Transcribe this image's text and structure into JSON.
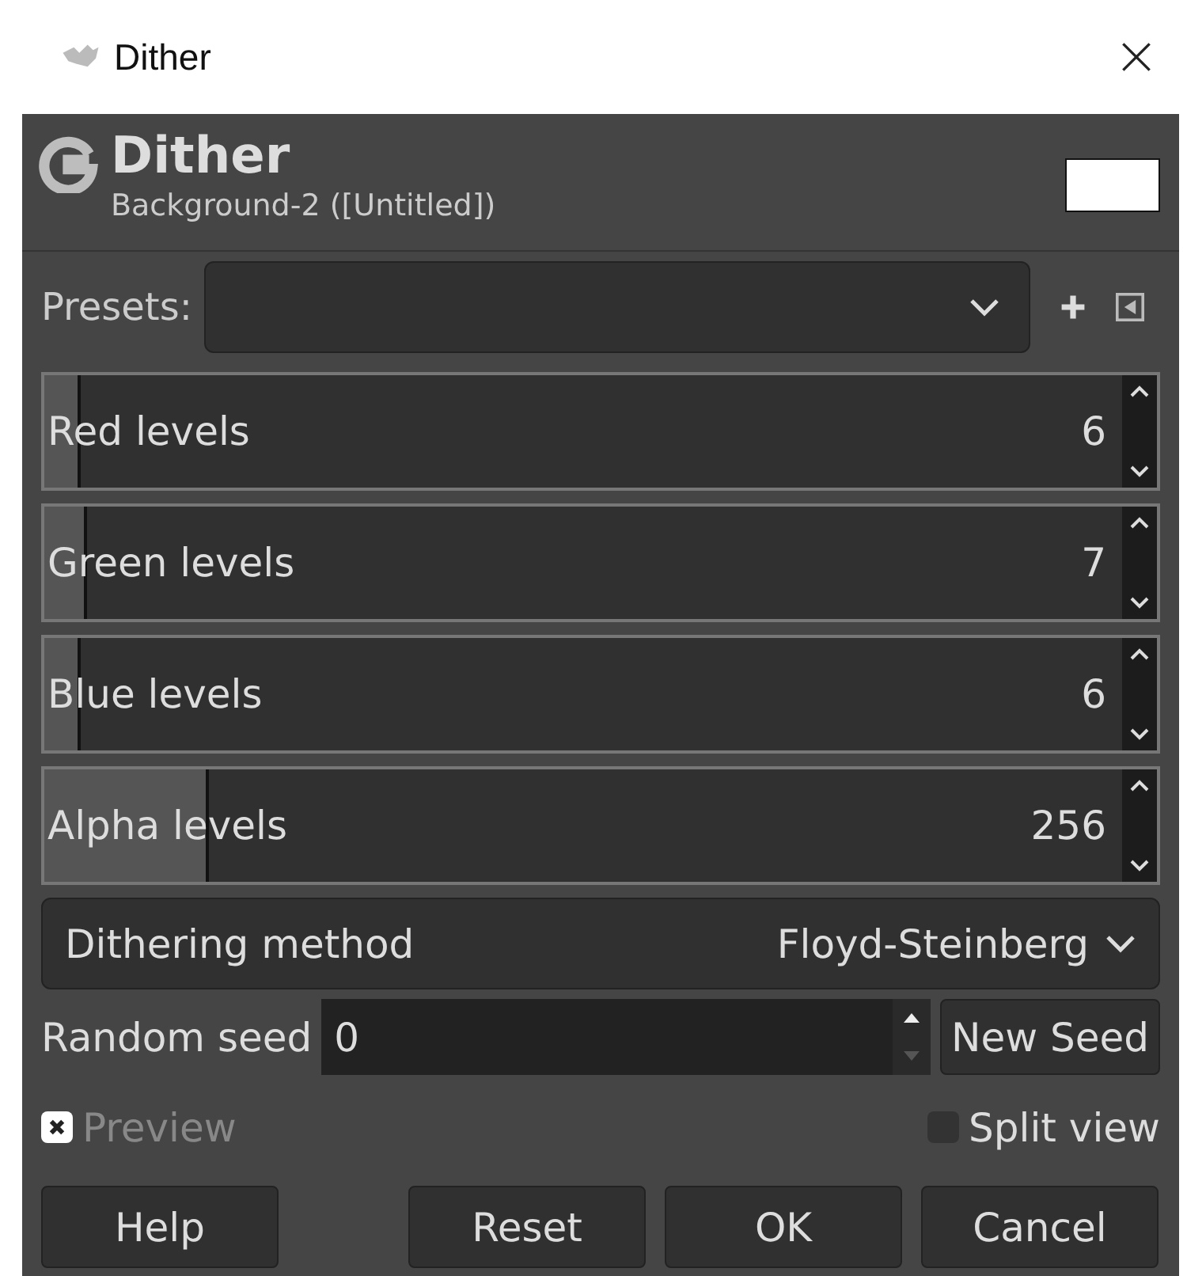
{
  "window": {
    "title": "Dither"
  },
  "header": {
    "title": "Dither",
    "subtitle": "Background-2 ([Untitled])"
  },
  "presets": {
    "label": "Presets:"
  },
  "sliders": [
    {
      "label": "Red levels",
      "value": "6",
      "level": 0.03
    },
    {
      "label": "Green levels",
      "value": "7",
      "level": 0.035
    },
    {
      "label": "Blue levels",
      "value": "6",
      "level": 0.03
    },
    {
      "label": "Alpha levels",
      "value": "256",
      "level": 0.145
    }
  ],
  "method": {
    "label": "Dithering method",
    "value": "Floyd-Steinberg"
  },
  "seed": {
    "label": "Random seed",
    "value": "0",
    "button": "New Seed"
  },
  "preview": {
    "label": "Preview",
    "checked": true
  },
  "split_view": {
    "label": "Split view",
    "checked": false
  },
  "buttons": [
    "Help",
    "Reset",
    "OK",
    "Cancel"
  ]
}
